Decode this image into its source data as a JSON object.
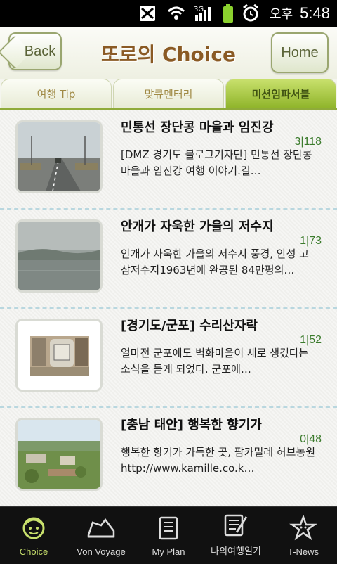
{
  "status_bar": {
    "ampm": "오후",
    "time": "5:48",
    "icons": [
      "sim-off-icon",
      "wifi-icon",
      "3g-signal-icon",
      "battery-icon",
      "alarm-icon"
    ]
  },
  "header": {
    "back_label": "Back",
    "title": "또로의 Choice",
    "home_label": "Home"
  },
  "tabs": [
    {
      "label": "여행 Tip"
    },
    {
      "label": "맞큐멘터리"
    },
    {
      "label": "미션임파서블"
    }
  ],
  "items": [
    {
      "title": "민통선 장단콩 마을과 임진강",
      "count": "3|118",
      "desc": "[DMZ 경기도 블로그기자단] 민통선 장단콩 마을과 임진강 여행 이야기.길…"
    },
    {
      "title": "안개가 자욱한 가을의 저수지",
      "count": "1|73",
      "desc": "안개가 자욱한 가을의 저수지 풍경, 안성 고삼저수지1963년에 완공된 84만평의…"
    },
    {
      "title": "[경기도/군포] 수리산자락",
      "count": "1|52",
      "desc": "얼마전 군포에도 벽화마을이 새로 생겼다는 소식을 듣게 되었다. 군포에…"
    },
    {
      "title": "[충남 태안] 행복한 향기가",
      "count": "0|48",
      "desc": "행복한 향기가 가득한 곳, 팜카밀레 허브농원http://www.kamille.co.k…"
    }
  ],
  "bottom_nav": [
    {
      "label": "Choice",
      "icon": "smiley-icon"
    },
    {
      "label": "Von Voyage",
      "icon": "sneaker-icon"
    },
    {
      "label": "My Plan",
      "icon": "notebook-icon"
    },
    {
      "label": "나의여행일기",
      "icon": "diary-pen-icon"
    },
    {
      "label": "T-News",
      "icon": "star-character-icon"
    }
  ]
}
